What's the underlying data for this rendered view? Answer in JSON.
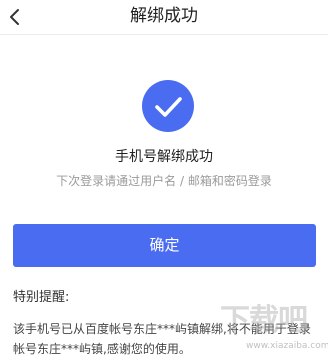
{
  "nav": {
    "back_icon": "chevron-left-icon",
    "title": "解绑成功"
  },
  "result": {
    "icon": "check-icon",
    "icon_color": "#4a6cf1",
    "title": "手机号解绑成功",
    "subtitle": "下次登录请通过用户名 / 邮箱和密码登录"
  },
  "confirm_button": {
    "label": "确定",
    "color": "#4a6cf1"
  },
  "notice": {
    "heading": "特别提醒:",
    "body": "该手机号已从百度帐号东庄***屿镇解绑,将不能用于登录帐号东庄***屿镇,感谢您的使用。"
  },
  "watermark": {
    "main": "下载吧",
    "url": "www.xiazaiba.com"
  }
}
